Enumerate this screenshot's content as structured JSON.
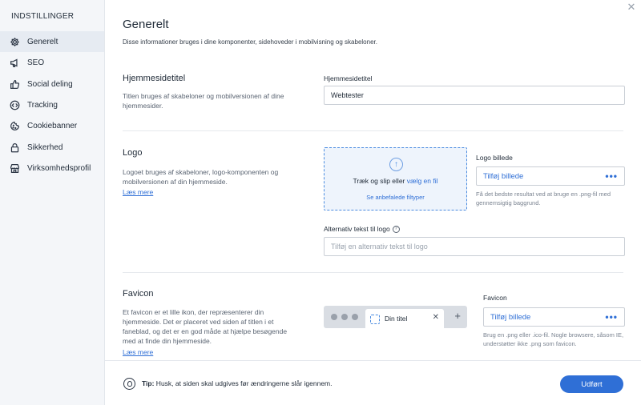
{
  "sidebar": {
    "title": "INDSTILLINGER",
    "items": [
      {
        "label": "Generelt",
        "icon": "gear-icon"
      },
      {
        "label": "SEO",
        "icon": "megaphone-icon"
      },
      {
        "label": "Social deling",
        "icon": "thumbs-up-icon"
      },
      {
        "label": "Tracking",
        "icon": "code-icon"
      },
      {
        "label": "Cookiebanner",
        "icon": "cookie-icon"
      },
      {
        "label": "Sikkerhed",
        "icon": "lock-icon"
      },
      {
        "label": "Virksomhedsprofil",
        "icon": "store-icon"
      }
    ]
  },
  "header": {
    "title": "Generelt",
    "subtitle": "Disse informationer bruges i dine komponenter, sidehoveder i mobilvisning og skabeloner."
  },
  "site_title": {
    "heading": "Hjemmesidetitel",
    "description": "Titlen bruges af skabeloner og mobilversionen af dine hjemmesider.",
    "field_label": "Hjemmesidetitel",
    "value": "Webtester"
  },
  "logo": {
    "heading": "Logo",
    "description": "Logoet bruges af skabeloner, logo-komponenten og mobilversionen af din hjemmeside.",
    "read_more": "Læs mere",
    "drop_text": "Træk og slip eller",
    "drop_link": "vælg en fil",
    "drop_sub": "Se anbefalede filtyper",
    "image_label": "Logo billede",
    "image_action": "Tilføj billede",
    "image_hint": "Få det bedste resultat ved at bruge en .png-fil med gennemsigtig baggrund.",
    "alt_label": "Alternativ tekst til logo",
    "alt_placeholder": "Tilføj en alternativ tekst til logo"
  },
  "favicon": {
    "heading": "Favicon",
    "description": "Et favicon er et lille ikon, der repræsenterer din hjemmeside. Det er placeret ved siden af titlen i et faneblad, og det er en god måde at hjælpe besøgende med at finde din hjemmeside.",
    "read_more": "Læs mere",
    "tab_title": "Din titel",
    "image_label": "Favicon",
    "image_action": "Tilføj billede",
    "image_hint": "Brug en .png eller .ico-fil. Nogle browsere, såsom IE, understøtter ikke .png som favicon."
  },
  "footer": {
    "tip_label": "Tip:",
    "tip_text": " Husk, at siden skal udgives før ændringerne slår igennem.",
    "done_label": "Udført"
  },
  "colors": {
    "accent": "#2f6fd6",
    "sidebar_bg": "#f4f6f9",
    "active_item_bg": "#e6ebf2"
  }
}
